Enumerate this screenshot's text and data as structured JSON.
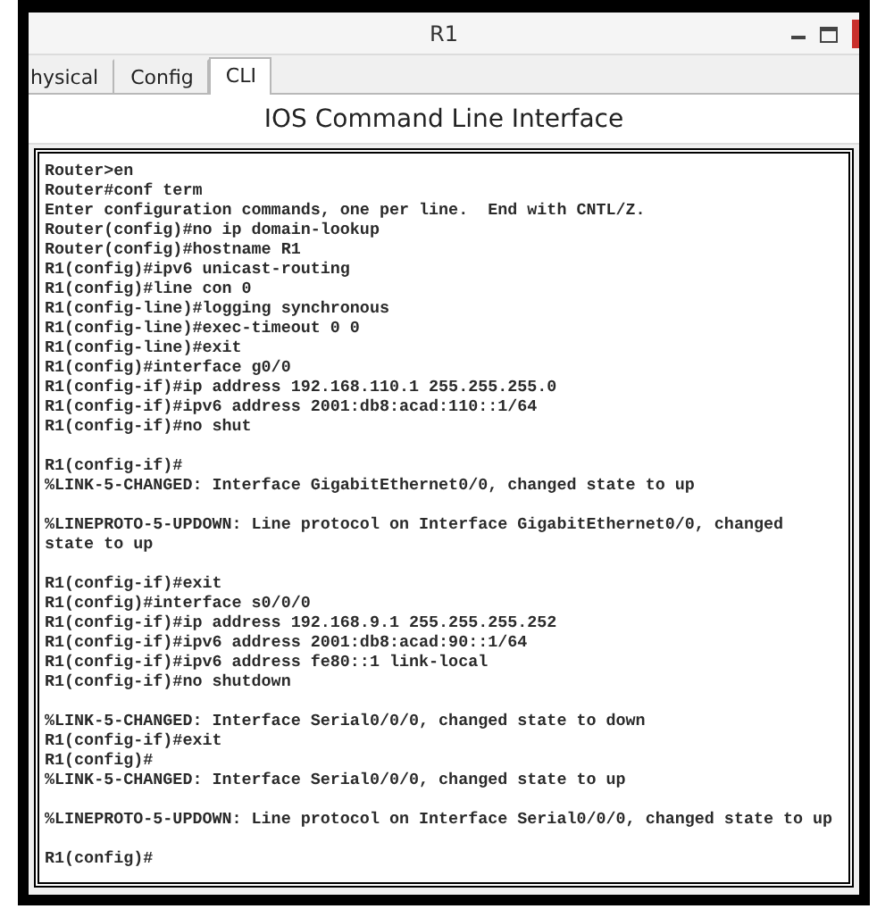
{
  "window": {
    "title": "R1"
  },
  "tabs": [
    {
      "label": "hysical",
      "selected": false
    },
    {
      "label": "Config",
      "selected": false
    },
    {
      "label": "CLI",
      "selected": true
    }
  ],
  "header": "IOS Command Line Interface",
  "terminal": {
    "blocks": [
      [
        "Router>en",
        "Router#conf term",
        "Enter configuration commands, one per line.  End with CNTL/Z.",
        "Router(config)#no ip domain-lookup",
        "Router(config)#hostname R1",
        "R1(config)#ipv6 unicast-routing",
        "R1(config)#line con 0",
        "R1(config-line)#logging synchronous",
        "R1(config-line)#exec-timeout 0 0",
        "R1(config-line)#exit",
        "R1(config)#interface g0/0",
        "R1(config-if)#ip address 192.168.110.1 255.255.255.0",
        "R1(config-if)#ipv6 address 2001:db8:acad:110::1/64",
        "R1(config-if)#no shut"
      ],
      [
        "R1(config-if)#",
        "%LINK-5-CHANGED: Interface GigabitEthernet0/0, changed state to up"
      ],
      [
        "%LINEPROTO-5-UPDOWN: Line protocol on Interface GigabitEthernet0/0, changed",
        "state to up"
      ],
      [
        "R1(config-if)#exit",
        "R1(config)#interface s0/0/0",
        "R1(config-if)#ip address 192.168.9.1 255.255.255.252",
        "R1(config-if)#ipv6 address 2001:db8:acad:90::1/64",
        "R1(config-if)#ipv6 address fe80::1 link-local",
        "R1(config-if)#no shutdown"
      ],
      [
        "%LINK-5-CHANGED: Interface Serial0/0/0, changed state to down",
        "R1(config-if)#exit",
        "R1(config)#",
        "%LINK-5-CHANGED: Interface Serial0/0/0, changed state to up"
      ],
      [
        "%LINEPROTO-5-UPDOWN: Line protocol on Interface Serial0/0/0, changed state to up"
      ],
      [
        "R1(config)#"
      ]
    ]
  }
}
